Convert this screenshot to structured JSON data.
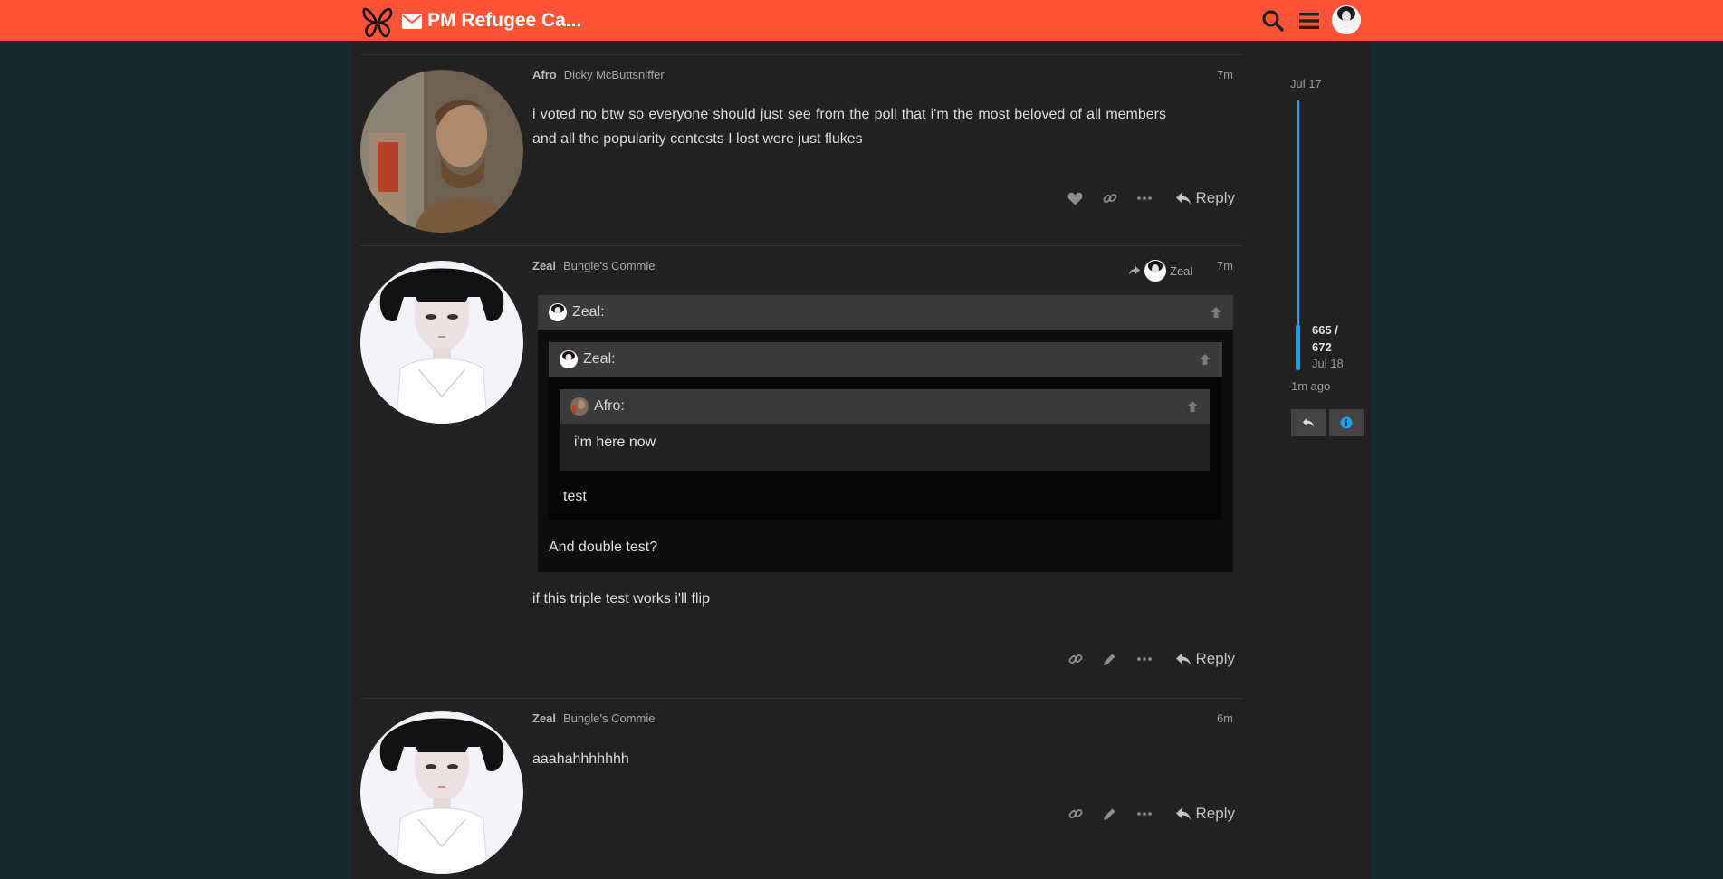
{
  "header": {
    "site_title": "PM Refugee Ca...",
    "icons": [
      "butterfly-logo",
      "envelope-icon",
      "search-icon",
      "hamburger-menu-icon",
      "user-avatar"
    ],
    "brand_color": "#ff5237"
  },
  "posts": [
    {
      "username": "Afro",
      "user_title": "Dicky McButtsniffer",
      "time": "7m",
      "body": "i voted no btw so everyone should just see from the poll that i'm the most beloved of all members and all the popularity contests I lost were just flukes",
      "actions": [
        "heart-icon",
        "link-icon",
        "more-icon"
      ],
      "reply_label": "Reply"
    },
    {
      "username": "Zeal",
      "user_title": "Bungle's Commie",
      "time": "7m",
      "reply_to_name": "Zeal",
      "quote": {
        "author": "Zeal:",
        "nested": {
          "author": "Zeal:",
          "nested": {
            "author": "Afro:",
            "text": "i'm here now"
          },
          "text": "test"
        },
        "text": "And double test?"
      },
      "body": "if this triple test works i'll flip",
      "actions": [
        "link-icon",
        "pencil-icon",
        "more-icon"
      ],
      "reply_label": "Reply"
    },
    {
      "username": "Zeal",
      "user_title": "Bungle's Commie",
      "time": "6m",
      "body": "aaahahhhhhhh",
      "actions": [
        "link-icon",
        "pencil-icon",
        "more-icon"
      ],
      "reply_label": "Reply"
    }
  ],
  "timeline": {
    "start_date": "Jul 17",
    "position": "665 /",
    "position_total": "672",
    "current_date": "Jul 18",
    "last_activity": "1m ago",
    "progress_fraction": 0.99,
    "accent_color": "#1aa3e8"
  }
}
